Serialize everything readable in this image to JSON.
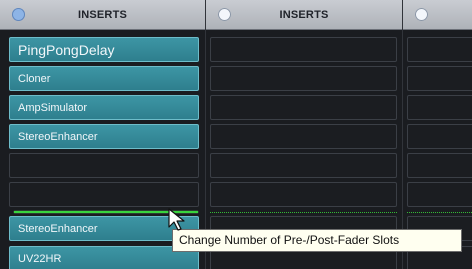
{
  "channels": [
    {
      "header": "INSERTS",
      "slots": [
        "PingPongDelay",
        "Cloner",
        "AmpSimulator",
        "StereoEnhancer",
        "",
        "",
        "StereoEnhancer",
        "UV22HR"
      ]
    },
    {
      "header": "INSERTS"
    },
    {
      "header": ""
    }
  ],
  "tooltip": "Change Number of Pre-/Post-Fader Slots",
  "colors": {
    "slot_fill": "#3a8f9e",
    "divider": "#39d43e",
    "header_bg": "#b7bbc1",
    "active_toggle": "#8db4e6"
  }
}
